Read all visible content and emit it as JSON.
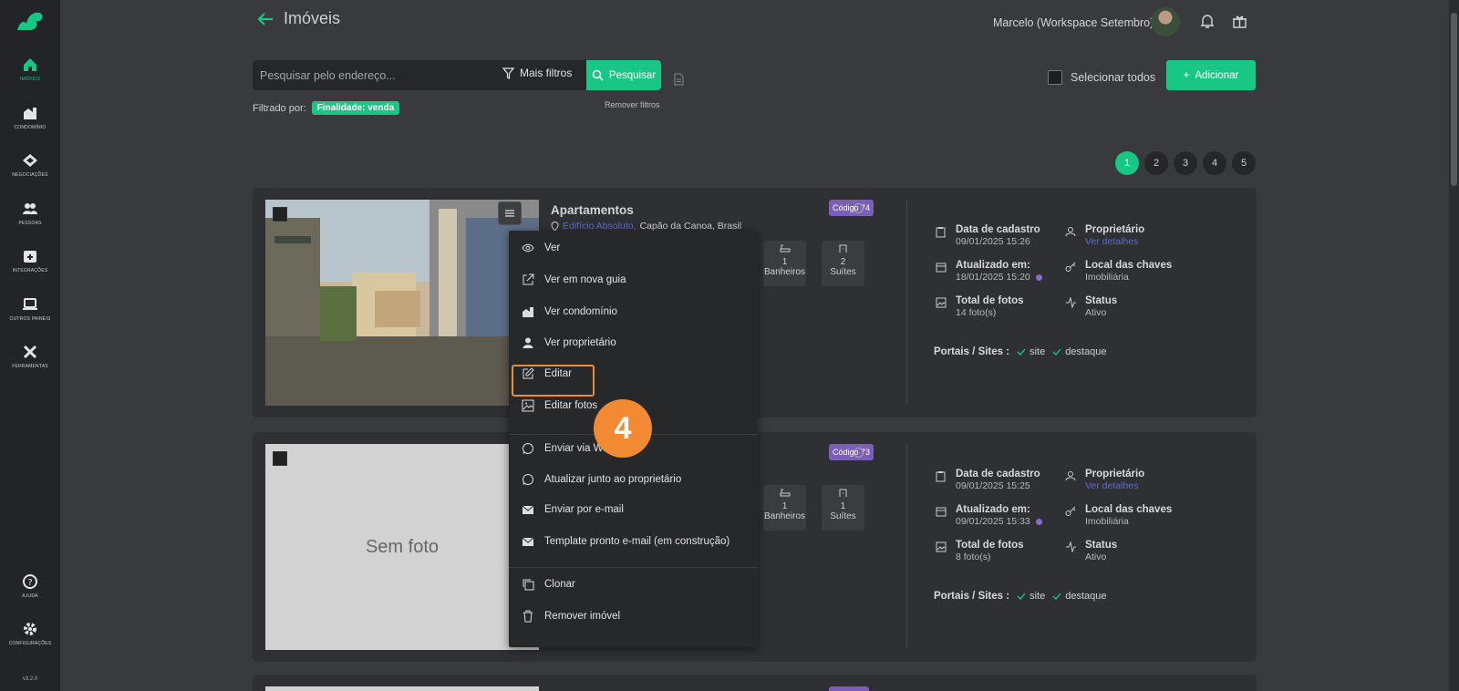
{
  "sidebar": {
    "items": [
      {
        "label": "Imóveis",
        "icon": "home-icon",
        "active": true
      },
      {
        "label": "Condomínio",
        "icon": "building-icon"
      },
      {
        "label": "Negociações",
        "icon": "handshake-icon"
      },
      {
        "label": "Pessoas",
        "icon": "people-icon"
      },
      {
        "label": "Integrações",
        "icon": "integration-icon"
      },
      {
        "label": "Outros painéis",
        "icon": "laptop-icon"
      },
      {
        "label": "Ferramentas",
        "icon": "tools-icon"
      },
      {
        "label": "Ajuda",
        "icon": "help-icon"
      },
      {
        "label": "Configurações",
        "icon": "gear-icon"
      }
    ],
    "version": "v3.2.0"
  },
  "header": {
    "title": "Imóveis",
    "user": "Marcelo (Workspace Setembro)"
  },
  "search": {
    "placeholder": "Pesquisar pelo endereço...",
    "more_filters": "Mais filtros",
    "button": "Pesquisar",
    "filtered_by": "Filtrado por:",
    "active_filter": "Finalidade: venda",
    "remove_filters": "Remover filtros"
  },
  "toolbar": {
    "select_all": "Selecionar todos",
    "add": "Adicionar"
  },
  "pagination": [
    "1",
    "2",
    "3",
    "4",
    "5"
  ],
  "cards": [
    {
      "type": "Apartamentos",
      "location_link": "Edifício Absoluto,",
      "location": "Capão da Canoa, Brasil",
      "code": "Código 74",
      "stats": [
        {
          "n": "1",
          "label": "Banheiros"
        },
        {
          "n": "2",
          "label": "Suítes"
        }
      ],
      "cadastro_label": "Data de cadastro",
      "cadastro": "09/01/2025 15:26",
      "atualizado_label": "Atualizado em:",
      "atualizado": "18/01/2025 15:20",
      "fotos_label": "Total de fotos",
      "fotos": "14 foto(s)",
      "proprietario_label": "Proprietário",
      "proprietario": "Ver detalhes",
      "chaves_label": "Local das chaves",
      "chaves": "Imobiliária",
      "status_label": "Status",
      "status": "Ativo",
      "portais_label": "Portais / Sites :",
      "portal1": "site",
      "portal2": "destaque"
    },
    {
      "code": "Código 73",
      "no_photo": "Sem foto",
      "stats": [
        {
          "n": "1",
          "label": "Banheiros"
        },
        {
          "n": "1",
          "label": "Suítes"
        }
      ],
      "cadastro_label": "Data de cadastro",
      "cadastro": "09/01/2025 15:25",
      "atualizado_label": "Atualizado em:",
      "atualizado": "09/01/2025 15:33",
      "fotos_label": "Total de fotos",
      "fotos": "8 foto(s)",
      "proprietario_label": "Proprietário",
      "proprietario": "Ver detalhes",
      "chaves_label": "Local das chaves",
      "chaves": "Imobiliária",
      "status_label": "Status",
      "status": "Ativo",
      "portais_label": "Portais / Sites :",
      "portal1": "site",
      "portal2": "destaque"
    }
  ],
  "context_menu": [
    {
      "label": "Ver",
      "icon": "eye-icon"
    },
    {
      "label": "Ver em nova guia",
      "icon": "external-link-icon"
    },
    {
      "label": "Ver condomínio",
      "icon": "building-icon"
    },
    {
      "label": "Ver proprietário",
      "icon": "user-icon"
    },
    {
      "label": "Editar",
      "icon": "edit-icon"
    },
    {
      "label": "Editar fotos",
      "icon": "image-icon"
    },
    {
      "label": "Enviar via WhatsApp",
      "icon": "whatsapp-icon"
    },
    {
      "label": "Atualizar junto ao proprietário",
      "icon": "whatsapp-icon"
    },
    {
      "label": "Enviar por e-mail",
      "icon": "mail-icon"
    },
    {
      "label": "Template pronto e-mail (em construção)",
      "icon": "mail-icon"
    },
    {
      "label": "Clonar",
      "icon": "copy-icon"
    },
    {
      "label": "Remover imóvel",
      "icon": "trash-icon"
    }
  ],
  "step_badge": "4",
  "colors": {
    "accent": "#19c785",
    "code_badge": "#7a5fb6",
    "highlight": "#f28b35",
    "link": "#5b6bd6"
  }
}
